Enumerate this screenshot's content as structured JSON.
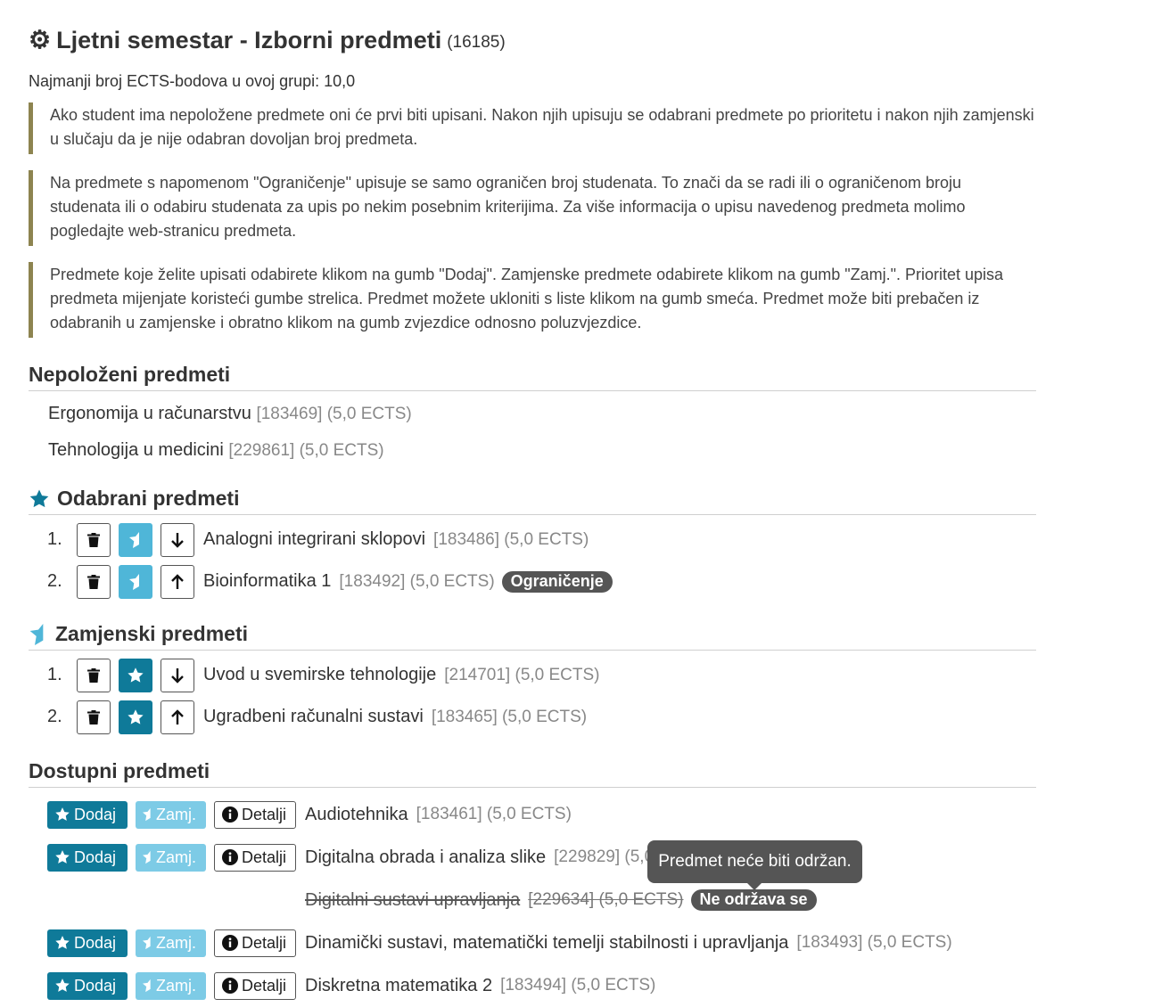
{
  "header": {
    "title": "Ljetni semestar - Izborni predmeti",
    "code": "(16185)",
    "min_ects": "Najmanji broj ECTS-bodova u ovoj grupi: 10,0"
  },
  "notes": [
    "Ako student ima nepoložene predmete oni će prvi biti upisani. Nakon njih upisuju se odabrani predmete po prioritetu i nakon njih zamjenski u slučaju da je nije odabran dovoljan broj predmeta.",
    "Na predmete s napomenom \"Ograničenje\" upisuje se samo ograničen broj studenata. To znači da se radi ili o ograničenom broju studenata ili o odabiru studenata za upis po nekim posebnim kriterijima. Za više informacija o upisu navedenog predmeta molimo pogledajte web-stranicu predmeta.",
    "Predmete koje želite upisati odabirete klikom na gumb \"Dodaj\". Zamjenske predmete odabirete klikom na gumb \"Zamj.\". Prioritet upisa predmeta mijenjate koristeći gumbe strelica. Predmet možete ukloniti s liste klikom na gumb smeća. Predmet može biti prebačen iz odabranih u zamjenske i obratno klikom na gumb zvjezdice odnosno poluzvjezdice."
  ],
  "nepolozeni": {
    "heading": "Nepoloženi predmeti",
    "items": [
      {
        "name": "Ergonomija u računarstvu",
        "meta": "[183469] (5,0 ECTS)"
      },
      {
        "name": "Tehnologija u medicini",
        "meta": "[229861] (5,0 ECTS)"
      }
    ]
  },
  "odabrani": {
    "heading": "Odabrani predmeti",
    "items": [
      {
        "num": "1.",
        "name": "Analogni integrirani sklopovi",
        "meta": "[183486] (5,0 ECTS)"
      },
      {
        "num": "2.",
        "name": "Bioinformatika 1",
        "meta": "[183492] (5,0 ECTS)",
        "badge": "Ograničenje"
      }
    ]
  },
  "zamjenski": {
    "heading": "Zamjenski predmeti",
    "items": [
      {
        "num": "1.",
        "name": "Uvod u svemirske tehnologije",
        "meta": "[214701] (5,0 ECTS)"
      },
      {
        "num": "2.",
        "name": "Ugradbeni računalni sustavi",
        "meta": "[183465] (5,0 ECTS)"
      }
    ]
  },
  "dostupni": {
    "heading": "Dostupni predmeti",
    "buttons": {
      "add": "Dodaj",
      "zamj": "Zamj.",
      "details": "Detalji"
    },
    "items": [
      {
        "name": "Audiotehnika",
        "meta": "[183461] (5,0 ECTS)"
      },
      {
        "name": "Digitalna obrada i analiza slike",
        "meta": "[229829] (5,0 ECTS)"
      },
      {
        "name": "Digitalni sustavi upravljanja",
        "meta": "[229634] (5,0 ECTS)",
        "badge": "Ne održava se"
      },
      {
        "name": "Dinamički sustavi, matematički temelji stabilnosti i upravljanja",
        "meta": "[183493] (5,0 ECTS)"
      },
      {
        "name": "Diskretna matematika 2",
        "meta": "[183494] (5,0 ECTS)"
      }
    ]
  },
  "tooltip": "Predmet neće biti održan.",
  "colors": {
    "accent_dark": "#0f7a99",
    "accent_light": "#4fb6d8",
    "note_border": "#8d8450",
    "badge": "#555555"
  },
  "icons": [
    "gear-icon",
    "star-icon",
    "half-star-icon",
    "trash-icon",
    "arrow-down-icon",
    "arrow-up-icon",
    "info-icon"
  ]
}
